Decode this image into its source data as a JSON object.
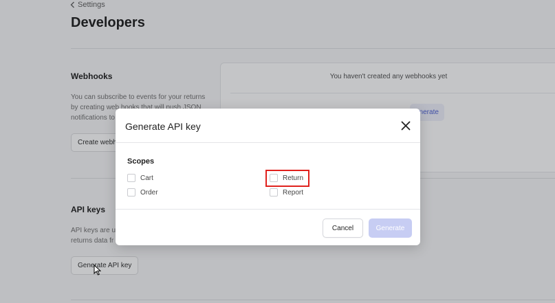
{
  "breadcrumb": {
    "label": "Settings"
  },
  "page": {
    "title": "Developers"
  },
  "webhooks": {
    "title": "Webhooks",
    "description_lines": [
      "You can subscribe to events for your returns",
      "by creating web hooks that will push JSON",
      "notifications to"
    ],
    "create_button": "Create webh",
    "empty_message": "You haven't created any webhooks yet",
    "generate_link": "enerate"
  },
  "api_keys": {
    "title": "API keys",
    "description_lines": [
      "API keys are u",
      "returns data fr"
    ],
    "generate_button": "Generate API key"
  },
  "modal": {
    "title": "Generate API key",
    "scopes_label": "Scopes",
    "scopes": [
      {
        "label": "Cart",
        "checked": false
      },
      {
        "label": "Return",
        "checked": false
      },
      {
        "label": "Order",
        "checked": false
      },
      {
        "label": "Report",
        "checked": false
      }
    ],
    "cancel_label": "Cancel",
    "generate_label": "Generate"
  },
  "colors": {
    "accent": "#4256d0",
    "generate_disabled": "#c7cdf3",
    "highlight": "#e0201c"
  }
}
